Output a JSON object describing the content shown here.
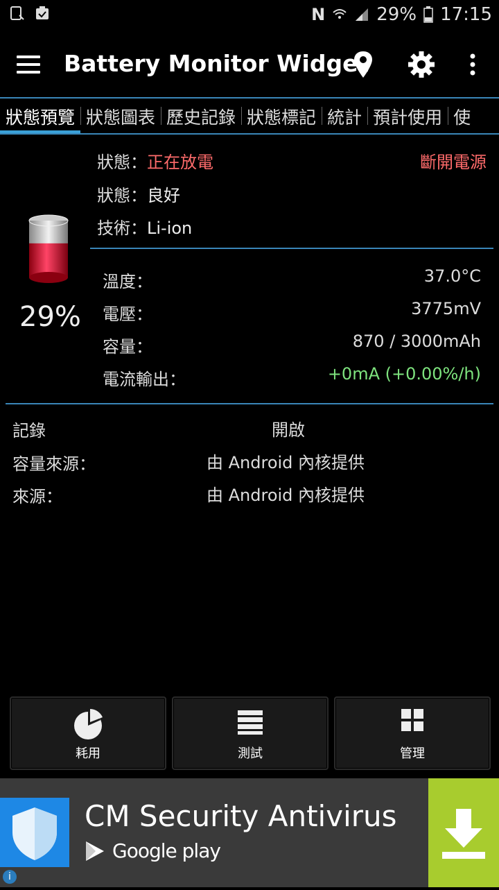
{
  "status_bar": {
    "battery_percent": "29%",
    "time": "17:15",
    "icons": [
      "notification-icon",
      "clipboard-icon",
      "nfc-icon",
      "wifi-icon",
      "signal-icon",
      "battery-icon"
    ]
  },
  "app_bar": {
    "title": "Battery Monitor Widget",
    "actions": [
      "location-pin-icon",
      "settings-gear-icon",
      "overflow-menu-icon"
    ]
  },
  "tabs": [
    "狀態預覽",
    "狀態圖表",
    "歷史記錄",
    "狀態標記",
    "統計",
    "預計使用",
    "使"
  ],
  "battery": {
    "percent": "29%",
    "level": 0.29
  },
  "status_info": {
    "state_label": "狀態：",
    "state_value": "正在放電",
    "power_source": "斷開電源",
    "health_label": "狀態：",
    "health_value": "良好",
    "tech_label": "技術：",
    "tech_value": "Li-ion"
  },
  "readings": [
    {
      "label": "溫度：",
      "value": "37.0°C"
    },
    {
      "label": "電壓：",
      "value": "3775mV"
    },
    {
      "label": "容量：",
      "value": "870 / 3000mAh"
    },
    {
      "label": "電流輸出：",
      "value": "+0mA (+0.00%/h)"
    }
  ],
  "log_section": {
    "log_label": "記錄",
    "log_value": "開啟",
    "capacity_source_label": "容量來源：",
    "capacity_source_value": "由 Android 內核提供",
    "source_label": "來源：",
    "source_value": "由 Android 內核提供"
  },
  "bottom_buttons": [
    {
      "label": "耗用",
      "icon": "pie-chart-icon"
    },
    {
      "label": "測試",
      "icon": "list-icon"
    },
    {
      "label": "管理",
      "icon": "grid-icon"
    }
  ],
  "ad": {
    "title": "CM Security Antivirus",
    "store": "Google play",
    "accent": "#a8cc2e"
  }
}
